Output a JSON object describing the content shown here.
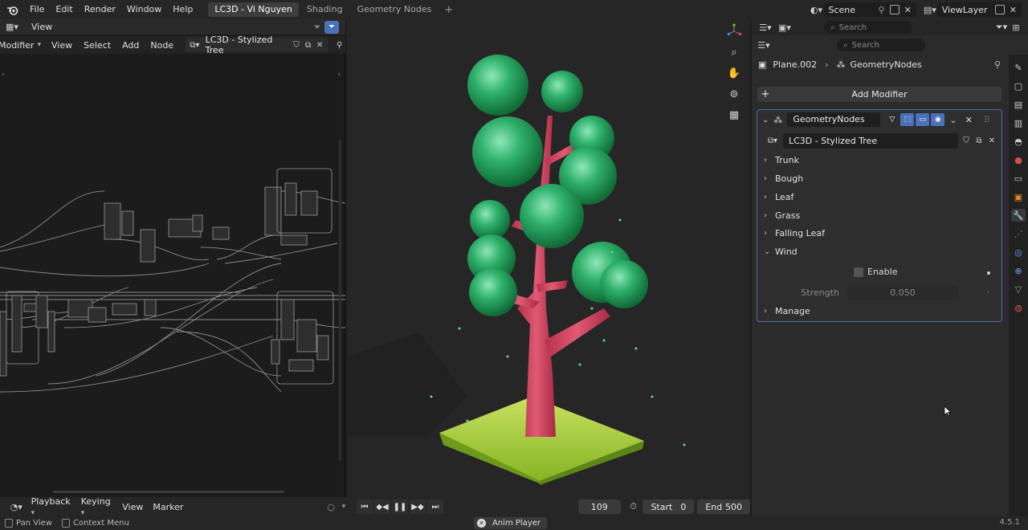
{
  "menubar": {
    "logo_icon": "blender-logo-icon",
    "items": [
      "File",
      "Edit",
      "Render",
      "Window",
      "Help"
    ],
    "workspace_tabs": [
      "LC3D - Vi Nguyen",
      "Shading",
      "Geometry Nodes"
    ],
    "add_tab": "+",
    "scene": "Scene",
    "view_layer": "ViewLayer"
  },
  "node_editor": {
    "header1_view": "View",
    "header2": {
      "editor_type": "Modifier",
      "menus": [
        "View",
        "Select",
        "Add",
        "Node"
      ],
      "node_tree": "LC3D - Stylized Tree"
    }
  },
  "properties": {
    "search_placeholder_top": "Search",
    "search_placeholder": "Search",
    "breadcrumb": {
      "object": "Plane.002",
      "modifier": "GeometryNodes"
    },
    "add_modifier": "Add Modifier",
    "modifier": {
      "name": "GeometryNodes",
      "node_group": "LC3D - Stylized Tree",
      "sections": [
        "Trunk",
        "Bough",
        "Leaf",
        "Grass",
        "Falling Leaf",
        "Wind",
        "Manage"
      ],
      "wind": {
        "enable_label": "Enable",
        "enable_checked": false,
        "strength_label": "Strength",
        "strength_value": "0.050"
      }
    },
    "accent_color": "#4a72b8"
  },
  "timeline": {
    "menus": [
      "Playback",
      "Keying",
      "View",
      "Marker"
    ],
    "current_frame": "109",
    "start_label": "Start",
    "start_value": "0",
    "end_label": "End",
    "end_value": "500"
  },
  "statusbar": {
    "pan_view": "Pan View",
    "context_menu": "Context Menu",
    "anim_player": "Anim Player",
    "version": "4.5.1"
  }
}
